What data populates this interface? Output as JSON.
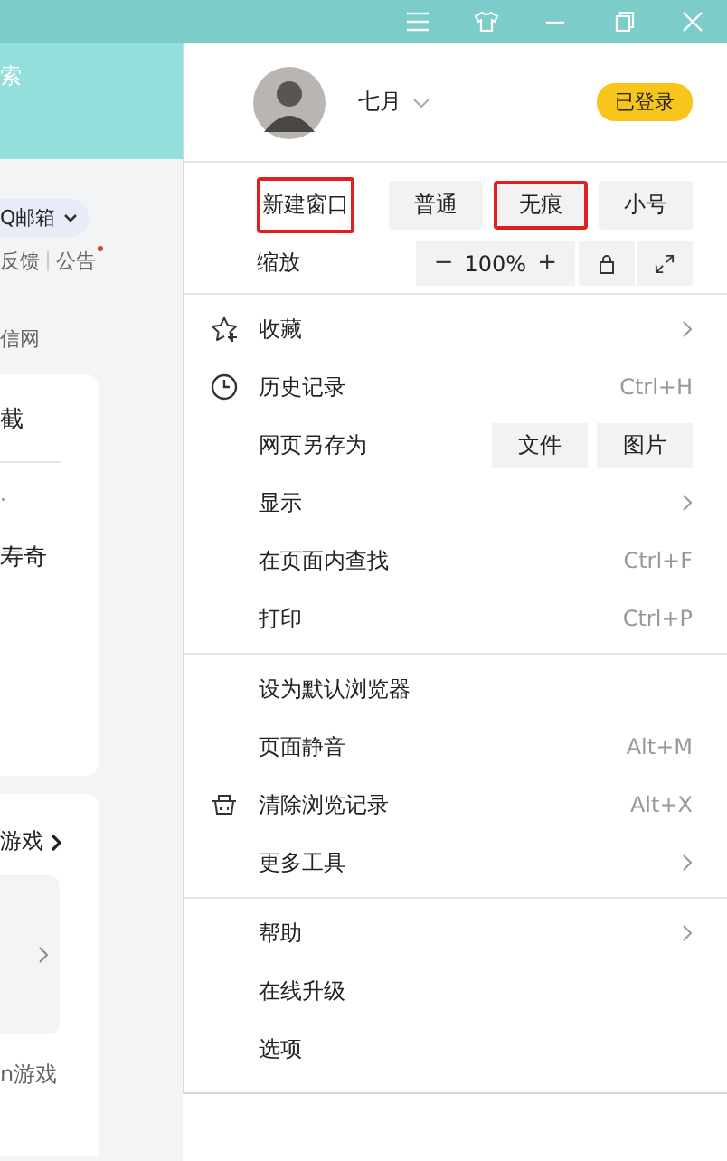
{
  "title_bar": {
    "buttons": [
      {
        "kind": "menu"
      },
      {
        "kind": "skin"
      },
      {
        "kind": "minimize"
      },
      {
        "kind": "restore"
      },
      {
        "kind": "close"
      }
    ]
  },
  "page": {
    "search_fragment": "索",
    "mail_pill": "Q邮箱",
    "links": [
      "反馈",
      "公告"
    ],
    "notice_dot": true,
    "site_fragment": "信网",
    "card_texts": [
      "截",
      "·",
      "寿奇"
    ],
    "games_title": "游戏",
    "games_footer": "n游戏"
  },
  "menu": {
    "user": {
      "name": "七月",
      "badge": "已登录"
    },
    "window_row": {
      "label": "新建窗口",
      "highlighted": true,
      "modes": [
        {
          "label": "普通",
          "highlighted": false
        },
        {
          "label": "无痕",
          "highlighted": true
        },
        {
          "label": "小号",
          "highlighted": false
        }
      ]
    },
    "zoom": {
      "label": "缩放",
      "minus": "−",
      "value": "100%",
      "plus": "+"
    },
    "sections": [
      [
        {
          "label": "收藏",
          "kind": "submenu"
        },
        {
          "label": "历史记录",
          "kind": "shortcut",
          "shortcut": "Ctrl+H"
        },
        {
          "label": "网页另存为",
          "kind": "buttons",
          "buttons": [
            "文件",
            "图片"
          ]
        },
        {
          "label": "显示",
          "kind": "submenu"
        },
        {
          "label": "在页面内查找",
          "kind": "shortcut",
          "shortcut": "Ctrl+F"
        },
        {
          "label": "打印",
          "kind": "shortcut",
          "shortcut": "Ctrl+P"
        }
      ],
      [
        {
          "label": "设为默认浏览器",
          "kind": "plain"
        },
        {
          "label": "页面静音",
          "kind": "shortcut",
          "shortcut": "Alt+M"
        },
        {
          "label": "清除浏览记录",
          "kind": "shortcut",
          "shortcut": "Alt+X"
        },
        {
          "label": "更多工具",
          "kind": "submenu"
        }
      ],
      [
        {
          "label": "帮助",
          "kind": "submenu"
        },
        {
          "label": "在线升级",
          "kind": "plain"
        },
        {
          "label": "选项",
          "kind": "plain"
        }
      ]
    ]
  }
}
